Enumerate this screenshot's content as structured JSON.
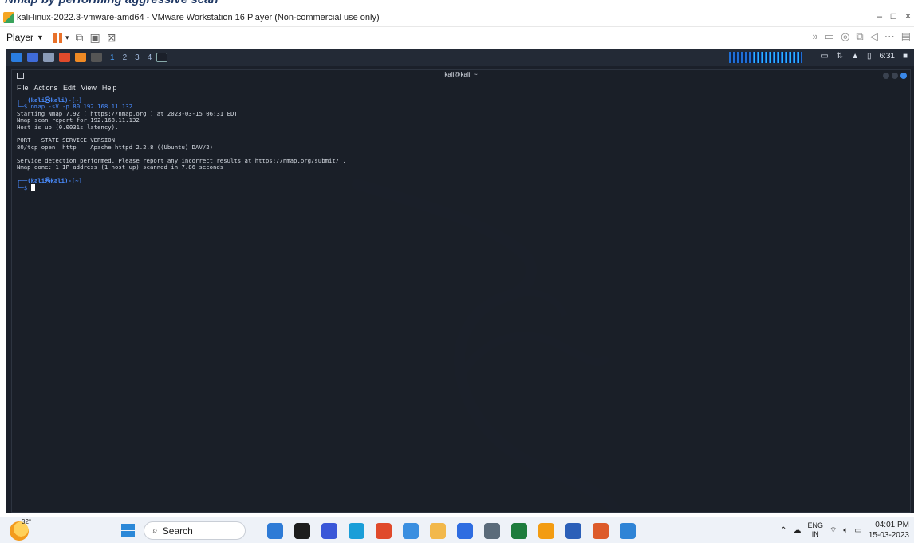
{
  "doc_heading": "Nmap by performing aggressive scan",
  "vmware": {
    "title": "kali-linux-2022.3-vmware-amd64 - VMware Workstation 16 Player (Non-commercial use only)",
    "player_label": "Player",
    "minimize": "–",
    "maximize": "□",
    "close": "×"
  },
  "kali_panel": {
    "workspaces": [
      "1",
      "2",
      "3",
      "4"
    ],
    "clock": "6:31"
  },
  "terminal": {
    "title": "kali@kali: ~",
    "menu": [
      "File",
      "Actions",
      "Edit",
      "View",
      "Help"
    ],
    "prompt_user": "(kali㉿kali)-[~]",
    "command": "nmap -sV -p 80 192.168.11.132",
    "output": [
      "Starting Nmap 7.92 ( https://nmap.org ) at 2023-03-15 06:31 EDT",
      "Nmap scan report for 192.168.11.132",
      "Host is up (0.0031s latency).",
      "",
      "PORT   STATE SERVICE VERSION",
      "80/tcp open  http    Apache httpd 2.2.8 ((Ubuntu) DAV/2)",
      "",
      "Service detection performed. Please report any incorrect results at https://nmap.org/submit/ .",
      "Nmap done: 1 IP address (1 host up) scanned in 7.86 seconds"
    ]
  },
  "taskbar": {
    "weather_temp": "32°",
    "search_label": "Search",
    "lang_top": "ENG",
    "lang_bottom": "IN",
    "time": "04:01 PM",
    "date": "15-03-2023",
    "app_colors": [
      "#2e7bd6",
      "#1d1d1d",
      "#3a57d8",
      "#1a9ed8",
      "#e04a2b",
      "#3b8fe0",
      "#f2b84b",
      "#2f6de1",
      "#5b6b7a",
      "#1e7c3d",
      "#f39c12",
      "#2b5fb8",
      "#dd5b2a",
      "#2f84d6"
    ]
  }
}
